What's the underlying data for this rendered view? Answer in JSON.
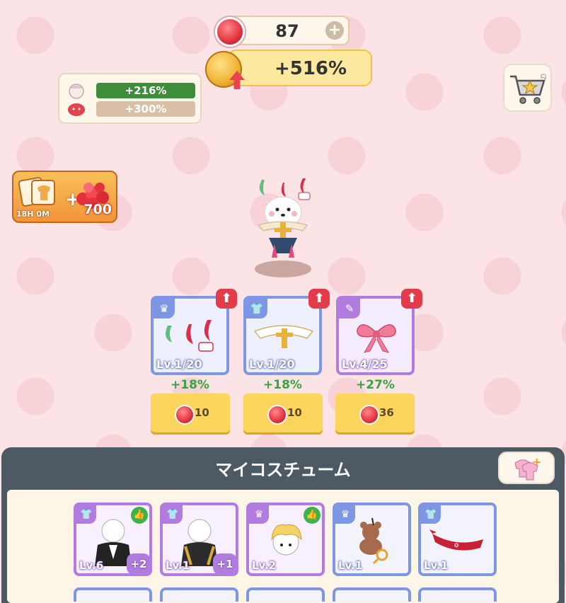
{
  "header": {
    "gems": "87",
    "gem_plus_icon": "plus-icon",
    "boost": "+516%"
  },
  "stats": {
    "stat1": "+216%",
    "stat2": "+300%"
  },
  "promo": {
    "timer": "18H 0M",
    "amount": "700"
  },
  "equipped": [
    {
      "category_icon": "hat-icon",
      "level": "Lv.1/20",
      "bonus": "+18%",
      "cost": "10"
    },
    {
      "category_icon": "shirt-icon",
      "level": "Lv.1/20",
      "bonus": "+18%",
      "cost": "10"
    },
    {
      "category_icon": "wand-icon",
      "level": "Lv.4/25",
      "bonus": "+27%",
      "cost": "36"
    }
  ],
  "panel": {
    "title": "マイコスチューム"
  },
  "inventory": [
    {
      "level": "Lv.6",
      "dup": "+2"
    },
    {
      "level": "Lv.1",
      "dup": "+1"
    },
    {
      "level": "Lv.2"
    },
    {
      "level": "Lv.1"
    },
    {
      "level": "Lv.1"
    }
  ],
  "colors": {
    "blue_frame": "#7d97e4",
    "purple_frame": "#b27be0",
    "bonus_green": "#3aa33f",
    "cost_yellow": "#fdd45c",
    "panel_bg": "#4e5a63"
  }
}
